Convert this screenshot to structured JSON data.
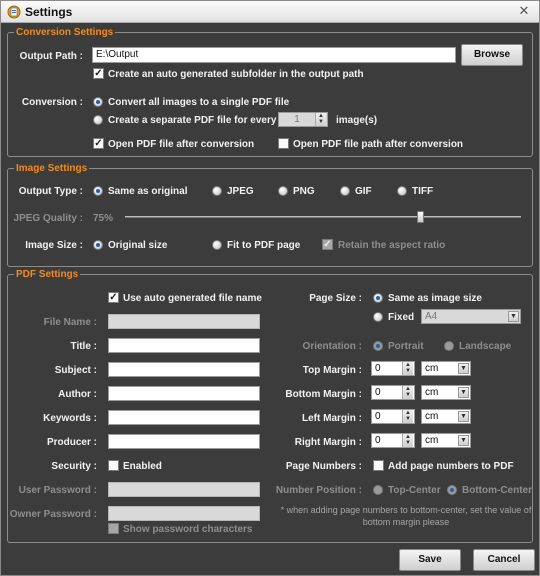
{
  "window": {
    "title": "Settings"
  },
  "conversion": {
    "legend": "Conversion Settings",
    "output_path_label": "Output Path :",
    "output_path_value": "E:\\Output",
    "browse_label": "Browse",
    "subfolder_label": "Create an auto generated subfolder in the output path",
    "subfolder_checked": true,
    "conversion_label": "Conversion :",
    "single_pdf_label": "Convert all images to a single PDF file",
    "separate_pdf_label": "Create a separate PDF file for every",
    "images_per_pdf": "1",
    "images_unit": "image(s)",
    "open_pdf_label": "Open PDF file after conversion",
    "open_pdf_checked": true,
    "open_path_label": "Open PDF file path after conversion",
    "open_path_checked": false
  },
  "image": {
    "legend": "Image Settings",
    "output_type_label": "Output Type :",
    "types": [
      "Same as original",
      "JPEG",
      "PNG",
      "GIF",
      "TIFF"
    ],
    "selected_type": "Same as original",
    "jpeg_quality_label": "JPEG Quality :",
    "jpeg_quality_value": "75%",
    "jpeg_quality_fraction": 0.75,
    "image_size_label": "Image Size :",
    "original_size_label": "Original size",
    "fit_pdf_label": "Fit to PDF page",
    "retain_ratio_label": "Retain the aspect ratio"
  },
  "pdf": {
    "legend": "PDF Settings",
    "auto_name_label": "Use auto generated file name",
    "auto_name_checked": true,
    "file_name_label": "File Name :",
    "title_label": "Title :",
    "subject_label": "Subject :",
    "author_label": "Author :",
    "keywords_label": "Keywords :",
    "producer_label": "Producer :",
    "security_label": "Security :",
    "enabled_label": "Enabled",
    "user_password_label": "User Password :",
    "owner_password_label": "Owner Password :",
    "show_password_label": "Show password characters",
    "page_size_label": "Page Size :",
    "same_as_image_label": "Same as image size",
    "fixed_label": "Fixed",
    "fixed_value": "A4",
    "orientation_label": "Orientation :",
    "portrait_label": "Portrait",
    "landscape_label": "Landscape",
    "top_margin_label": "Top Margin :",
    "bottom_margin_label": "Bottom Margin :",
    "left_margin_label": "Left Margin :",
    "right_margin_label": "Right Margin :",
    "margin_value": "0",
    "margin_unit": "cm",
    "page_numbers_label": "Page Numbers :",
    "add_page_numbers_label": "Add page numbers to PDF",
    "number_position_label": "Number Position :",
    "top_center_label": "Top-Center",
    "bottom_center_label": "Bottom-Center",
    "note": "* when adding page numbers to bottom-center, set the value of bottom margin please"
  },
  "footer": {
    "save_label": "Save",
    "cancel_label": "Cancel"
  },
  "colors": {
    "accent": "#f28c1e",
    "background": "#3c3c3c"
  }
}
